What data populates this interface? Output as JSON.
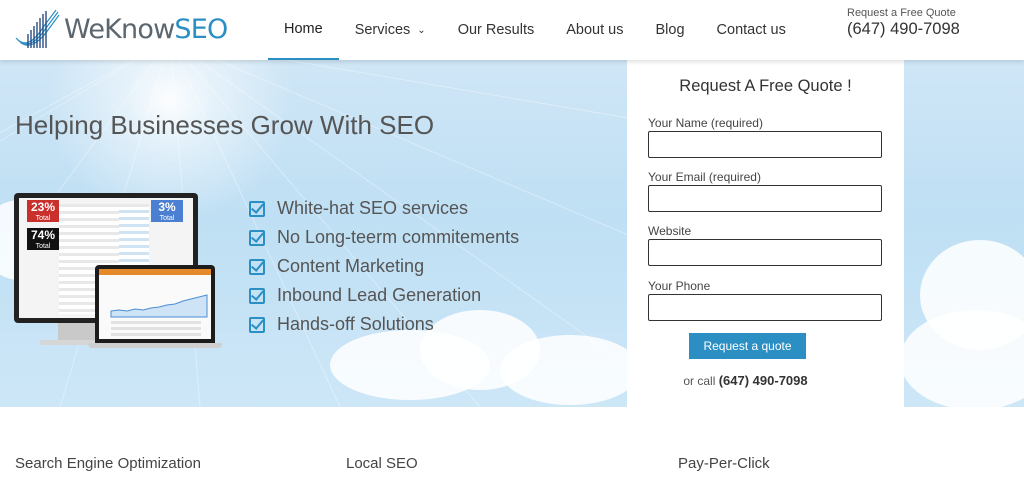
{
  "brand": {
    "name_part1": "WeKnow",
    "name_part2": "SEO",
    "accent": "#2b8fc4"
  },
  "nav": {
    "items": [
      {
        "label": "Home",
        "active": true
      },
      {
        "label": "Services",
        "dropdown": true
      },
      {
        "label": "Our Results"
      },
      {
        "label": "About us"
      },
      {
        "label": "Blog"
      },
      {
        "label": "Contact us"
      }
    ],
    "quote_small": "Request a Free Quote",
    "quote_phone": "(647) 490-7098"
  },
  "hero": {
    "title": "Helping Businesses Grow With SEO",
    "features": [
      "White-hat SEO services",
      "No Long-teerm commitements",
      "Content Marketing",
      "Inbound Lead Generation",
      "Hands-off Solutions"
    ],
    "badges": [
      {
        "value": "23%",
        "label": "Total"
      },
      {
        "value": "74%",
        "label": "Total"
      },
      {
        "value": "3%",
        "label": "Total"
      }
    ]
  },
  "quote_form": {
    "title": "Request A Free Quote !",
    "fields": [
      {
        "label": "Your Name (required)",
        "value": ""
      },
      {
        "label": "Your Email (required)",
        "value": ""
      },
      {
        "label": "Website",
        "value": ""
      },
      {
        "label": "Your Phone",
        "value": ""
      }
    ],
    "button": "Request a quote",
    "call_prefix": "or call",
    "call_phone": "(647) 490-7098"
  },
  "services": [
    {
      "title": "Search Engine Optimization"
    },
    {
      "title": "Local SEO"
    },
    {
      "title": "Pay-Per-Click"
    }
  ]
}
